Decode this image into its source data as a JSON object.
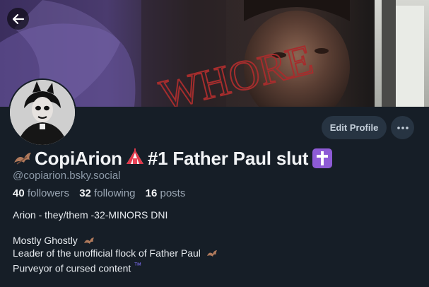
{
  "profile": {
    "display_name": {
      "part1": "CopiArion",
      "part2": "#1 Father Paul slut"
    },
    "handle": "@copiarion.bsky.social",
    "stats": {
      "followers_count": "40",
      "followers_label": "followers",
      "following_count": "32",
      "following_label": "following",
      "posts_count": "16",
      "posts_label": "posts"
    },
    "bio": {
      "line1": "Arion - they/them -32-MINORS DNI",
      "line2": "Mostly Ghostly",
      "line3": "Leader of the unofficial flock of Father Paul",
      "line4": "Purveyor of cursed content",
      "line4_suffix": "™"
    }
  },
  "banner": {
    "graffiti_text": "WHORE"
  },
  "actions": {
    "edit_profile_label": "Edit Profile",
    "back_icon": "arrow-left-icon",
    "more_icon": "more-horizontal-icon"
  },
  "colors": {
    "background": "#161e27",
    "button_bg": "#273442",
    "muted_text": "#8b98a6",
    "primary_text": "#f1f3f5",
    "accent_purple": "#8e5bd6",
    "graffiti_red": "#9b2a2a"
  }
}
